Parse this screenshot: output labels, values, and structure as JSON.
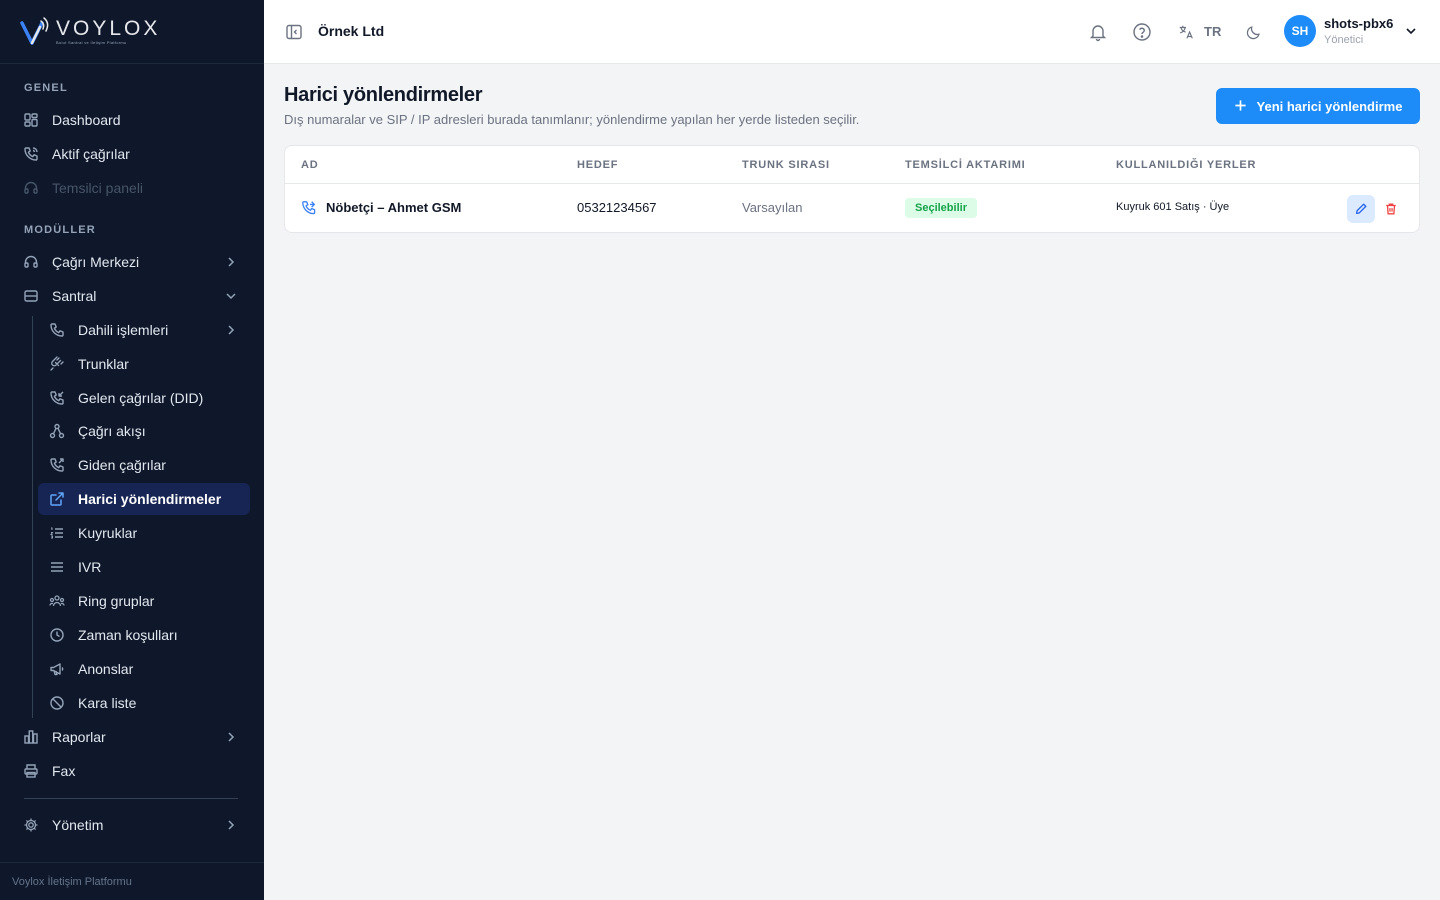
{
  "brand": {
    "name": "VOYLOX",
    "tagline": "Bulut Santral ve İletişim Platformu"
  },
  "sidebar": {
    "section_general": "GENEL",
    "section_modules": "MODÜLLER",
    "general_items": [
      {
        "label": "Dashboard",
        "icon": "dashboard-icon"
      },
      {
        "label": "Aktif çağrılar",
        "icon": "phone-icon"
      },
      {
        "label": "Temsilci paneli",
        "icon": "headset-icon"
      }
    ],
    "modules": [
      {
        "label": "Çağrı Merkezi",
        "icon": "headset-icon"
      },
      {
        "label": "Santral",
        "icon": "server-icon"
      }
    ],
    "santral_items": [
      {
        "label": "Dahili işlemleri",
        "icon": "phone-icon"
      },
      {
        "label": "Trunklar",
        "icon": "plug-icon"
      },
      {
        "label": "Gelen çağrılar (DID)",
        "icon": "phone-incoming-icon"
      },
      {
        "label": "Çağrı akışı",
        "icon": "flow-icon"
      },
      {
        "label": "Giden çağrılar",
        "icon": "phone-outgoing-icon"
      },
      {
        "label": "Harici yönlendirmeler",
        "icon": "external-link-icon"
      },
      {
        "label": "Kuyruklar",
        "icon": "list-ordered-icon"
      },
      {
        "label": "IVR",
        "icon": "menu-icon"
      },
      {
        "label": "Ring gruplar",
        "icon": "users-icon"
      },
      {
        "label": "Zaman koşulları",
        "icon": "clock-icon"
      },
      {
        "label": "Anonslar",
        "icon": "megaphone-icon"
      },
      {
        "label": "Kara liste",
        "icon": "ban-icon"
      }
    ],
    "bottom_items": [
      {
        "label": "Raporlar",
        "icon": "chart-icon"
      },
      {
        "label": "Fax",
        "icon": "printer-icon"
      },
      {
        "label": "Yönetim",
        "icon": "gear-icon"
      }
    ],
    "footer": "Voylox İletişim Platformu"
  },
  "header": {
    "org": "Örnek Ltd",
    "lang": "TR",
    "user": {
      "initials": "SH",
      "name": "shots-pbx6",
      "role": "Yönetici"
    }
  },
  "main": {
    "title": "Harici yönlendirmeler",
    "subtitle": "Dış numaralar ve SIP / IP adresleri burada tanımlanır; yönlendirme yapılan her yerde listeden seçilir.",
    "new_button": "Yeni harici yönlendirme",
    "columns": [
      "AD",
      "HEDEF",
      "TRUNK SIRASI",
      "TEMSİLCİ AKTARIMI",
      "KULLANILDIĞI YERLER"
    ],
    "rows": [
      {
        "name": "Nöbetçi – Ahmet GSM",
        "target": "05321234567",
        "trunk_order": "Varsayılan",
        "agent_transfer": "Seçilebilir",
        "used_in": "Kuyruk 601 Satış · Üye"
      }
    ]
  },
  "colors": {
    "accent": "#1d8cf8",
    "sidebar_bg": "#0f172a",
    "active_bg": "#172554",
    "success": "#16a34a"
  }
}
